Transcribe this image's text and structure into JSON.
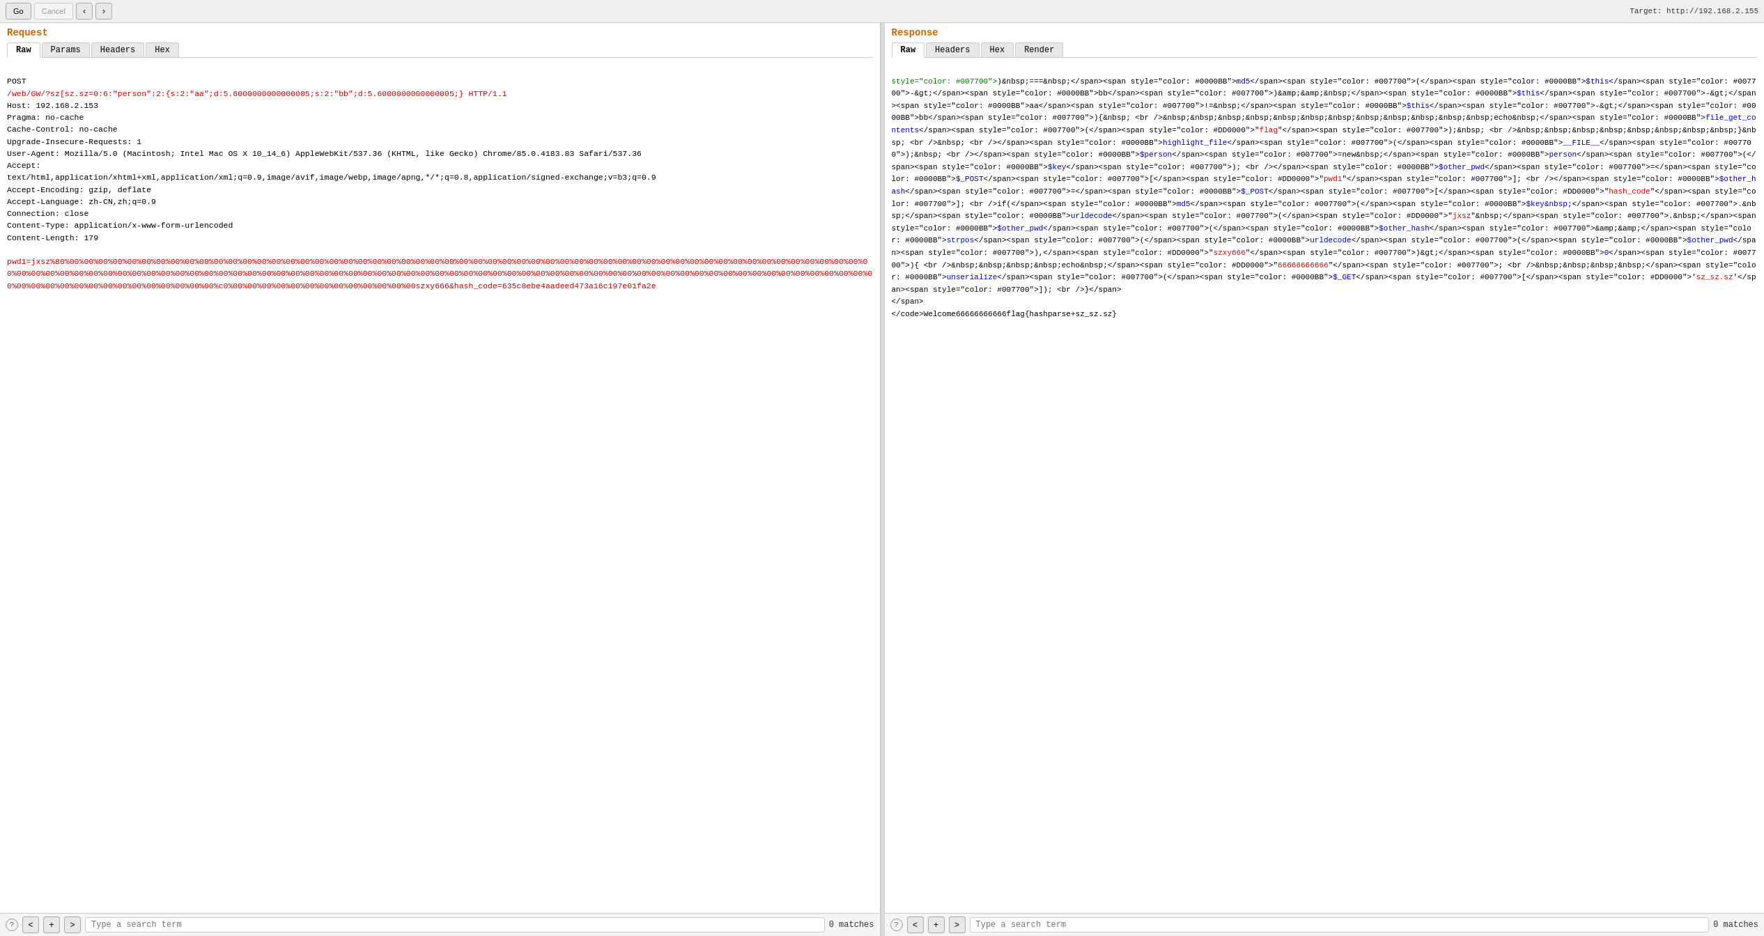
{
  "topbar": {
    "go_label": "Go",
    "cancel_label": "Cancel",
    "target_label": "Target: http://192.168.2.155",
    "nav_prev": "‹",
    "nav_next": "›"
  },
  "request": {
    "title": "Request",
    "tabs": [
      "Raw",
      "Params",
      "Headers",
      "Hex"
    ],
    "active_tab": "Raw",
    "content_lines": [
      "POST",
      "/web/GW/?sz[sz.sz=0:6:\"person\":2:{s:2:\"aa\";d:5.6000000000000005;s:2:\"bb\";d:5.6000000000000005;} HTTP/1.1",
      "Host: 192.168.2.153",
      "Pragma: no-cache",
      "Cache-Control: no-cache",
      "Upgrade-Insecure-Requests: 1",
      "User-Agent: Mozilla/5.0 (Macintosh; Intel Mac OS X 10_14_6) AppleWebKit/537.36 (KHTML, like Gecko) Chrome/85.0.4183.83 Safari/537.36",
      "Accept:",
      "text/html,application/xhtml+xml,application/xml;q=0.9,image/avif,image/webp,image/apng,*/*;q=0.8,application/signed-exchange;v=b3;q=0.9",
      "Accept-Encoding: gzip, deflate",
      "Accept-Language: zh-CN,zh;q=0.9",
      "Connection: close",
      "Content-Type: application/x-www-form-urlencoded",
      "Content-Length: 179",
      "",
      "pwd1=jxsz%80%00%00%00%00%00%00%00%00%00%00%00%00%00%00%00%00%00%00%00%00%00%00%00%00%00%00%00%00%00%00%00%00%00%00%00%00%00%00%00%00%00%00%00%00%00%00%00%00%00%00%00%00%00%00%00%00%00%00%00%00%00%00%00%00%00%00%00%00%00%00%00%00%00%00%00%00%00%00%00%00%00%00%00%00%00%00%00%00%00%00%00%00%00%00%00%00%00%00%00%00%00%00%00%00%00%00%00%00%00%00%00%00%00%00%00%00%00%00%00%00%00%00%00%00%00%00%00%00%00%00%c0%00%00%00%00%00%00%00%00%00%00%00%00%00szxy666&hash_code=635c8ebe4aadeed473a16c197e01fa2e"
    ],
    "footer": {
      "search_placeholder": "Type a search term",
      "matches_label": "0 matches"
    }
  },
  "response": {
    "title": "Response",
    "tabs": [
      "Raw",
      "Headers",
      "Hex",
      "Render"
    ],
    "active_tab": "Raw",
    "footer": {
      "search_placeholder": "Type a search term",
      "matches_label": "0 matches"
    }
  },
  "icons": {
    "help": "?",
    "prev": "<",
    "next": ">"
  }
}
